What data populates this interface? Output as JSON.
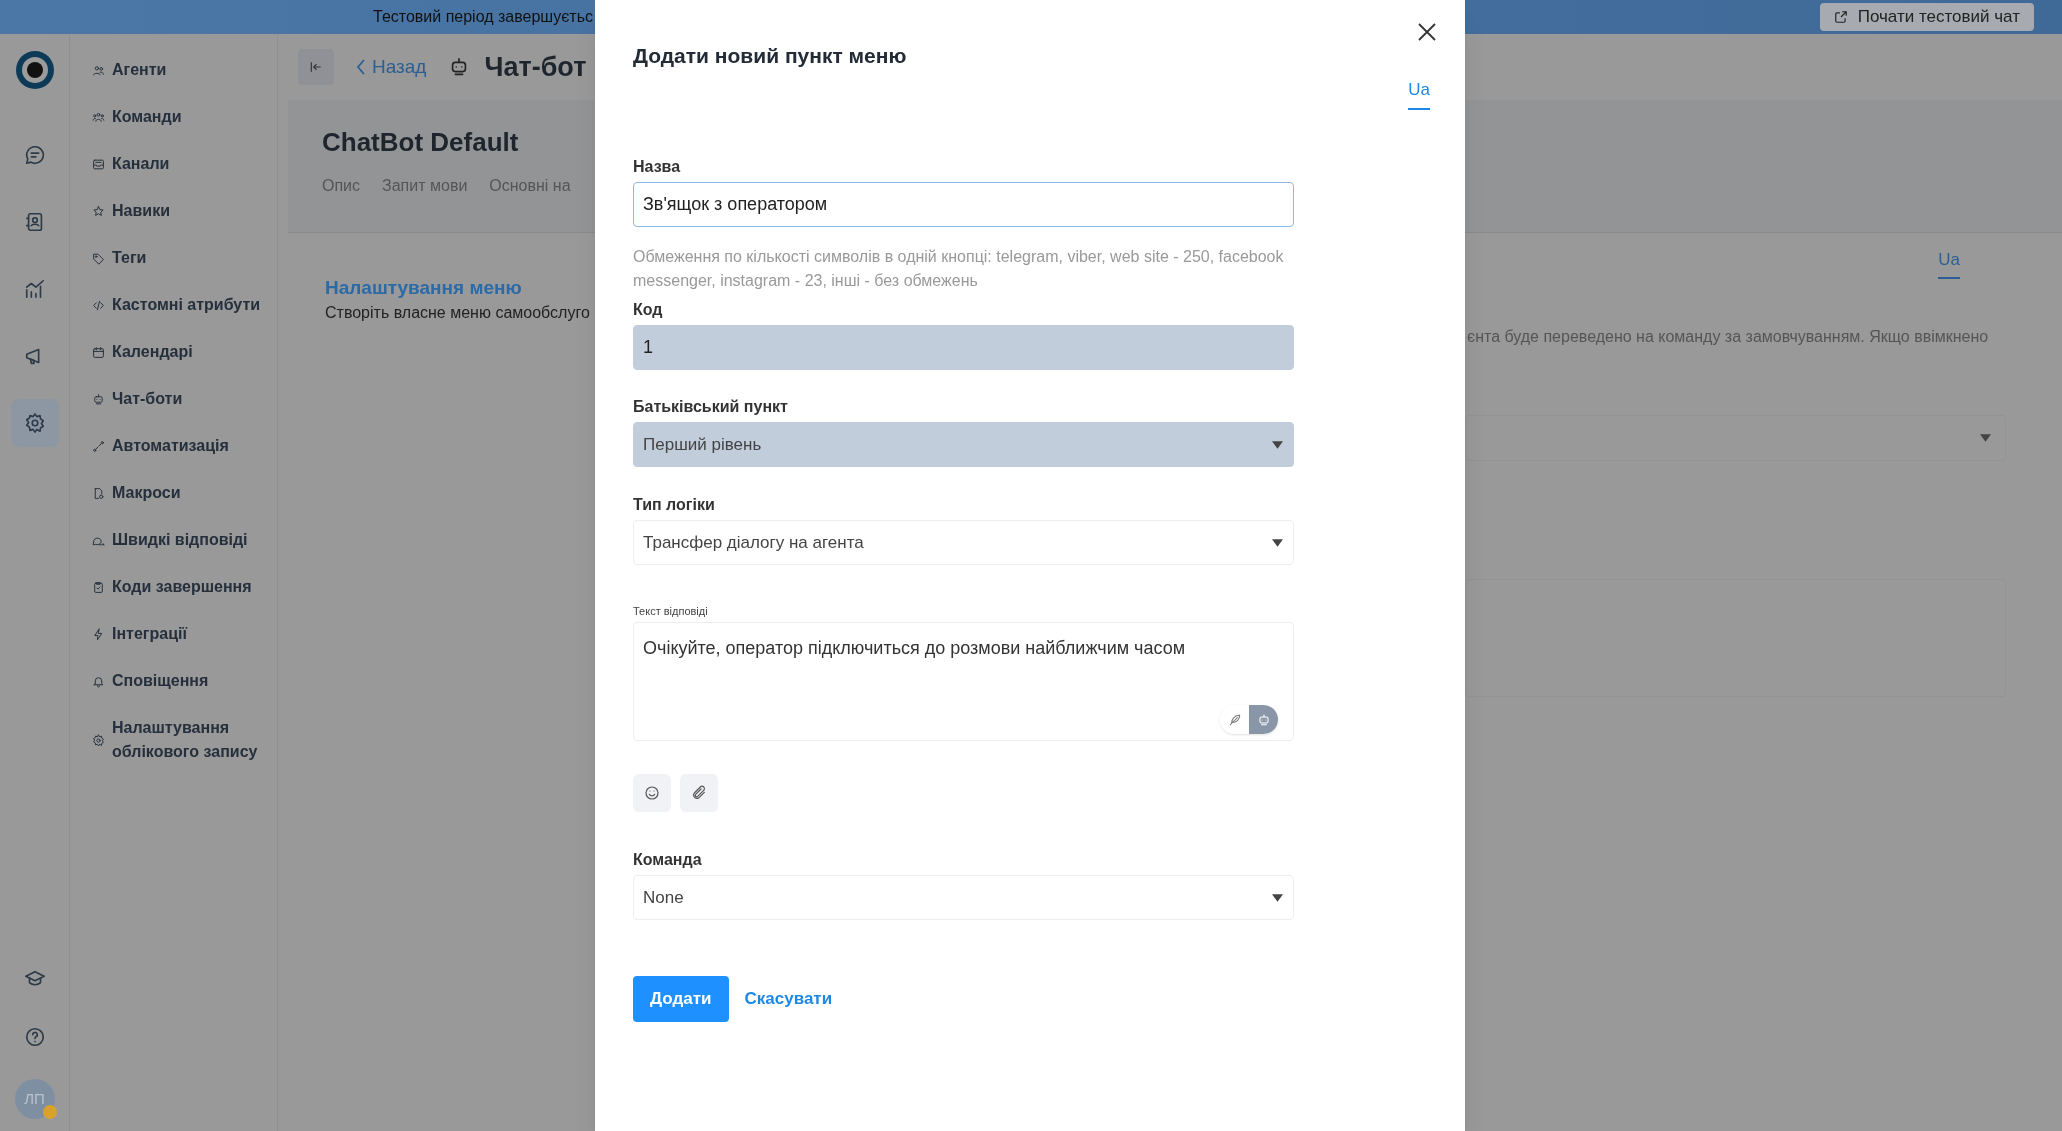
{
  "banner": {
    "text": "Тестовий період завершуєтьс",
    "button": "Почати тестовий чат"
  },
  "rail": {
    "items": [
      {
        "kind": "chat",
        "selected": false
      },
      {
        "kind": "contacts",
        "selected": false
      },
      {
        "kind": "chart",
        "selected": false
      },
      {
        "kind": "megaphone",
        "selected": false
      },
      {
        "kind": "gear",
        "selected": true
      }
    ],
    "bottom": [
      {
        "kind": "cap"
      },
      {
        "kind": "help"
      }
    ],
    "avatar": {
      "initials": "ЛП"
    }
  },
  "nav": {
    "items": [
      {
        "label": "Агенти",
        "kind": "users"
      },
      {
        "label": "Команди",
        "kind": "group"
      },
      {
        "label": "Канали",
        "kind": "inbox"
      },
      {
        "label": "Навики",
        "kind": "star"
      },
      {
        "label": "Теги",
        "kind": "tag"
      },
      {
        "label": "Кастомні атрибути",
        "kind": "code"
      },
      {
        "label": "Календарі",
        "kind": "calendar"
      },
      {
        "label": "Чат-боти",
        "kind": "robot"
      },
      {
        "label": "Автоматизація",
        "kind": "path"
      },
      {
        "label": "Макроси",
        "kind": "file"
      },
      {
        "label": "Швидкі відповіді",
        "kind": "bubbles"
      },
      {
        "label": "Коди завершення",
        "kind": "clipboard"
      },
      {
        "label": "Інтеграції",
        "kind": "bolt"
      },
      {
        "label": "Сповіщення",
        "kind": "bell"
      },
      {
        "label": "Налаштування облікового запису",
        "kind": "gear"
      }
    ]
  },
  "header": {
    "back": "Назад",
    "title": "Чат-бот"
  },
  "bot": {
    "name": "ChatBot Default",
    "tabs": [
      {
        "label": "Опис",
        "selected": false
      },
      {
        "label": "Запит мови",
        "selected": false
      },
      {
        "label": "Основні на",
        "selected": false
      }
    ]
  },
  "section": {
    "title": "Налаштування меню",
    "description": "Створіть власне меню самообслуго"
  },
  "background_right": {
    "lang_tab": {
      "label": "Ua",
      "selected": true
    },
    "text": "єнта буде переведено на команду за замовчуванням. Якщо ввімкнено"
  },
  "modal": {
    "title": "Додати новий пункт меню",
    "lang_tabs": [
      {
        "label": "Ua",
        "selected": true
      }
    ],
    "fields": [
      {
        "kind": "input",
        "label": "Назва",
        "value": "Зв'ящок з оператором",
        "focused": true,
        "disabled": false,
        "hint": "Обмеження по кількості символів в одній кнопці: telegram, viber, web site - 250, facebook messenger, instagram - 23, інші - без обмежень"
      },
      {
        "kind": "input",
        "label": "Код",
        "value": "1",
        "disabled": true
      },
      {
        "kind": "select",
        "label": "Батьківський пункт",
        "value": "Перший рівень",
        "disabled": true
      },
      {
        "kind": "select",
        "label": "Тип логіки",
        "value": "Трансфер діалогу на агента",
        "disabled": false
      },
      {
        "kind": "textarea",
        "label": "Текст відповіді",
        "value": "Очікуйте, оператор підключиться до розмови найближчим часом",
        "modes": [
          {
            "kind": "feather",
            "selected": false
          },
          {
            "kind": "robot",
            "selected": true
          }
        ],
        "tools": [
          {
            "kind": "emoji"
          },
          {
            "kind": "attach"
          }
        ]
      },
      {
        "kind": "select",
        "label": "Команда",
        "value": "None",
        "disabled": false
      }
    ],
    "submit": "Додати",
    "cancel": "Скасувати"
  }
}
